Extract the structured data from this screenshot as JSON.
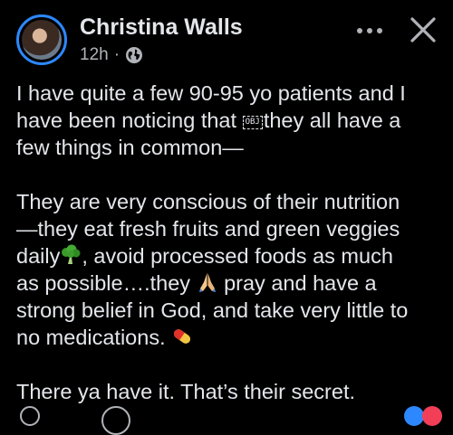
{
  "post": {
    "author": "Christina Walls",
    "time": "12h",
    "separator": "·",
    "privacy_icon": "globe-icon",
    "more_icon": "more-horizontal-icon",
    "close_icon": "close-icon",
    "paragraphs": [
      {
        "lines": [
          "I have quite a few 90-95 yo patients and I",
          "have been noticing that",
          "they all have a",
          "few things in common—"
        ],
        "obj_placeholder": "OBJ"
      },
      {
        "lines": [
          "They are very conscious of their nutrition",
          "—they eat fresh fruits and green veggies",
          "daily",
          ", avoid processed foods as much",
          "as possible….they",
          " pray and have a",
          "strong belief in God, and take very little to",
          "no medications."
        ],
        "emojis": [
          "broccoli-emoji",
          "folded-hands-emoji",
          "pill-emoji"
        ]
      },
      {
        "lines": [
          "There ya have it.  That’s their secret."
        ]
      }
    ]
  },
  "colors": {
    "background": "#000000",
    "text": "#e4e6eb",
    "secondary_text": "#b0b3b8",
    "story_ring": "#2d88ff"
  }
}
